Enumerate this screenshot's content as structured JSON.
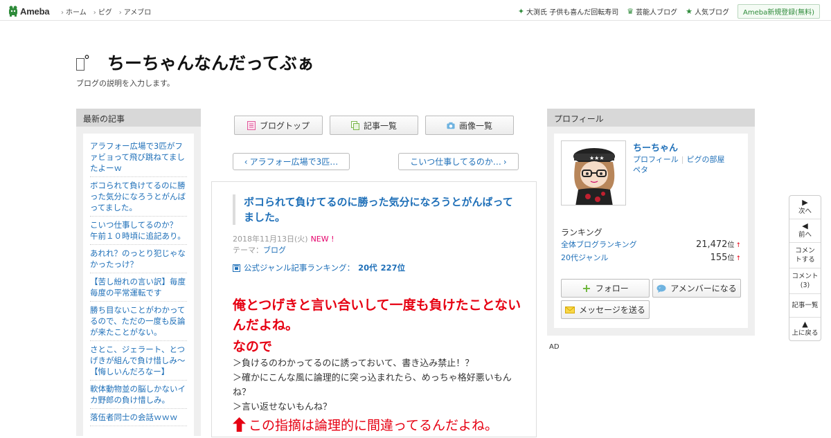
{
  "header": {
    "logo": "Ameba",
    "nav": [
      "ホーム",
      "ピグ",
      "アメブロ"
    ],
    "right_links": [
      {
        "icon": "star-icon",
        "label": "大渕氏 子供も喜んだ回転寿司"
      },
      {
        "icon": "crown-icon",
        "label": "芸能人ブログ"
      },
      {
        "icon": "star-icon",
        "label": "人気ブログ"
      }
    ],
    "register": "Ameba新規登録(無料)"
  },
  "blog": {
    "title": "ちーちゃんなんだってぶぁ",
    "title_prefix": "゜",
    "description": "ブログの説明を入力します。"
  },
  "left_sidebar": {
    "heading": "最新の記事",
    "items": [
      "アラフォー広場で3匹がファビョって飛び跳ねてましたよーｗ",
      "ボコられて負けてるのに勝った気分になろうとがんばってました。",
      "こいつ仕事してるのか？　午前１０時頃に追記あり。",
      "あれれ？のっとり犯じゃなかったっけ？",
      "【苦し紛れの言い訳】毎度毎度の平常運転です",
      "勝ち目ないことがわかってるので、ただの一度も反論が来たことがない。",
      "さとこ、ジェラート、とつげきが組んで負け惜しみ～【悔しいんだろなー】",
      "軟体動物並の脳しかないイカ野郎の負け惜しみ。",
      "落伍者同士の会話ｗｗｗ"
    ]
  },
  "tabs": {
    "blog_top": "ブログトップ",
    "entry_list": "記事一覧",
    "image_list": "画像一覧"
  },
  "pager": {
    "prev": "アラフォー広場で3匹…",
    "next": "こいつ仕事してるのか…"
  },
  "entry": {
    "title": "ボコられて負けてるのに勝った気分になろうとがんばってました。",
    "date": "2018年11月13日(火)",
    "new_badge": "NEW !",
    "theme_label": "テーマ：",
    "theme": "ブログ",
    "ranking_label": "公式ジャンル記事ランキング：",
    "ranking_genre": "20代",
    "ranking_rank": "227位",
    "big_text": "俺とつげきと言い合いして一度も負けたことないんだよね。",
    "mid_text": "なので",
    "lines": [
      "＞負けるのわかってるのに誘っておいて、書き込み禁止！？",
      "＞確かにこんな風に論理的に突っ込まれたら、めっちゃ格好悪いもんね？",
      "＞言い返せないもんね？"
    ],
    "last_text": "この指摘は論理的に間違ってるんだよね。"
  },
  "profile": {
    "heading": "プロフィール",
    "name": "ちーちゃん",
    "links": [
      "プロフィール",
      "ピグの部屋"
    ],
    "link3": "ペタ",
    "ranking_heading": "ランキング",
    "rankings": [
      {
        "label": "全体ブログランキング",
        "value": "21,472",
        "unit": "位",
        "trend": "↑"
      },
      {
        "label": "20代ジャンル",
        "value": "155",
        "unit": "位",
        "trend": "↑"
      }
    ],
    "follow": "フォロー",
    "amember": "アメンバーになる",
    "message": "メッセージを送る"
  },
  "ad_label": "AD",
  "float_nav": {
    "next": "次へ",
    "prev": "前へ",
    "comment": "コメントする",
    "comment_count_label": "コメント",
    "comment_count": "(3)",
    "entries": "記事一覧",
    "top": "上に戻る"
  },
  "colors": {
    "link": "#1e6fb8",
    "accent_red": "#e60012",
    "ameba_green": "#2e8b3a"
  }
}
